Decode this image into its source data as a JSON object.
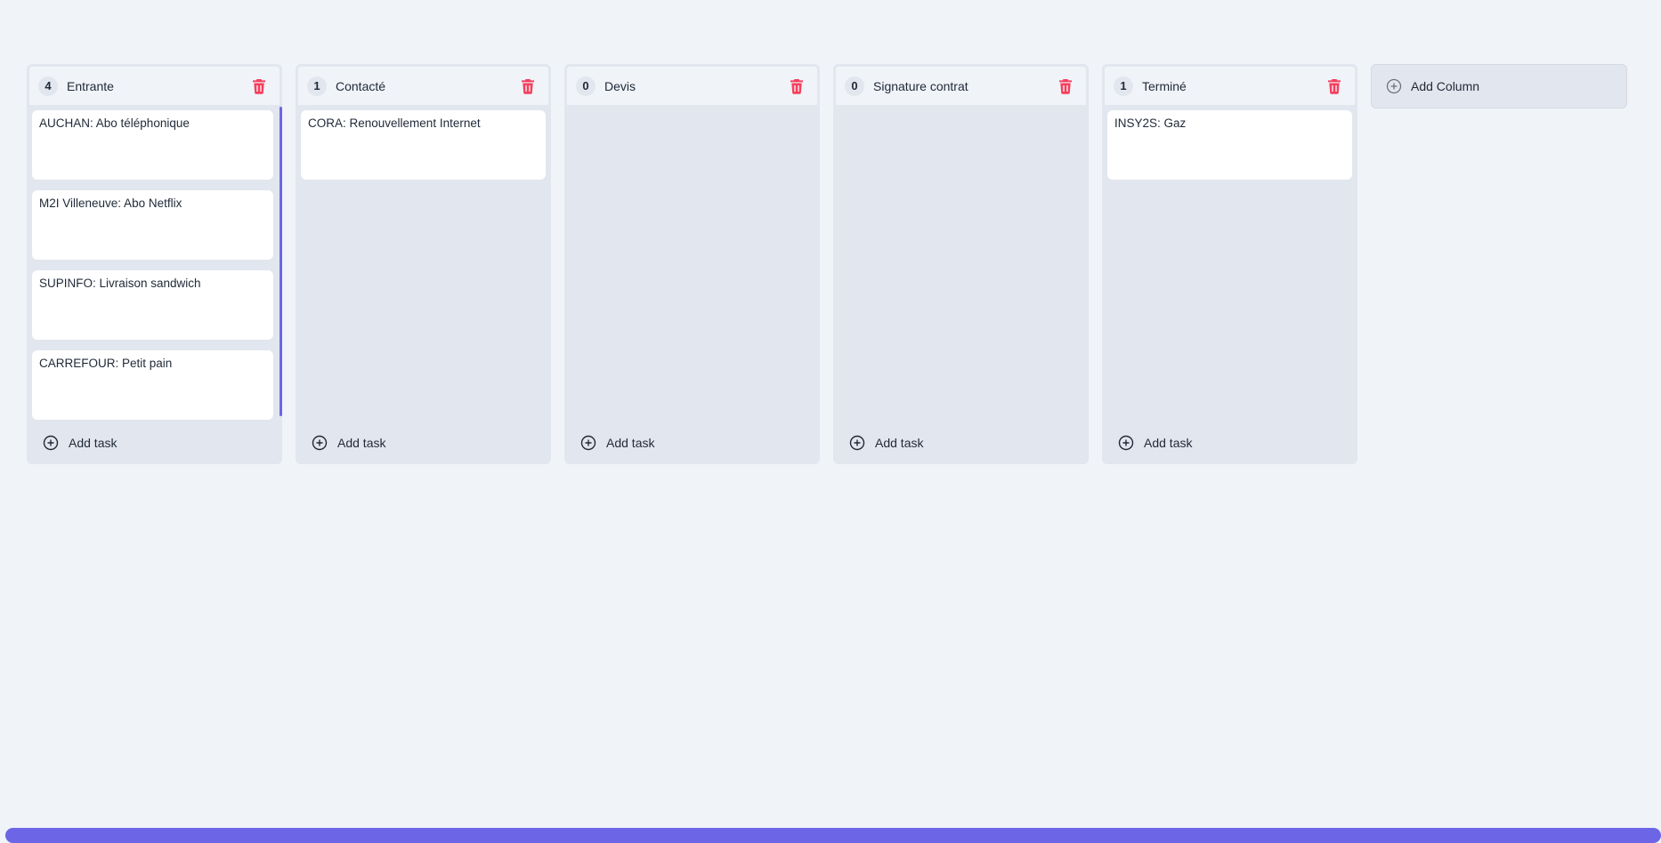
{
  "columns": [
    {
      "count": "4",
      "title": "Entrante",
      "tasks": [
        "AUCHAN: Abo téléphonique",
        "M2I Villeneuve: Abo Netflix",
        "SUPINFO: Livraison sandwich",
        "CARREFOUR: Petit pain"
      ],
      "add_task_label": "Add task"
    },
    {
      "count": "1",
      "title": "Contacté",
      "tasks": [
        "CORA: Renouvellement Internet"
      ],
      "add_task_label": "Add task"
    },
    {
      "count": "0",
      "title": "Devis",
      "tasks": [],
      "add_task_label": "Add task"
    },
    {
      "count": "0",
      "title": "Signature contrat",
      "tasks": [],
      "add_task_label": "Add task"
    },
    {
      "count": "1",
      "title": "Terminé",
      "tasks": [
        "INSY2S: Gaz"
      ],
      "add_task_label": "Add task"
    }
  ],
  "add_column_label": "Add Column",
  "colors": {
    "background": "#f0f3f8",
    "column": "#e2e6ee",
    "card": "#ffffff",
    "delete_icon": "#f43f5e",
    "scrollbar": "#6c66e6"
  },
  "icons": {
    "delete": "trash-icon",
    "add": "plus-circle-icon"
  }
}
